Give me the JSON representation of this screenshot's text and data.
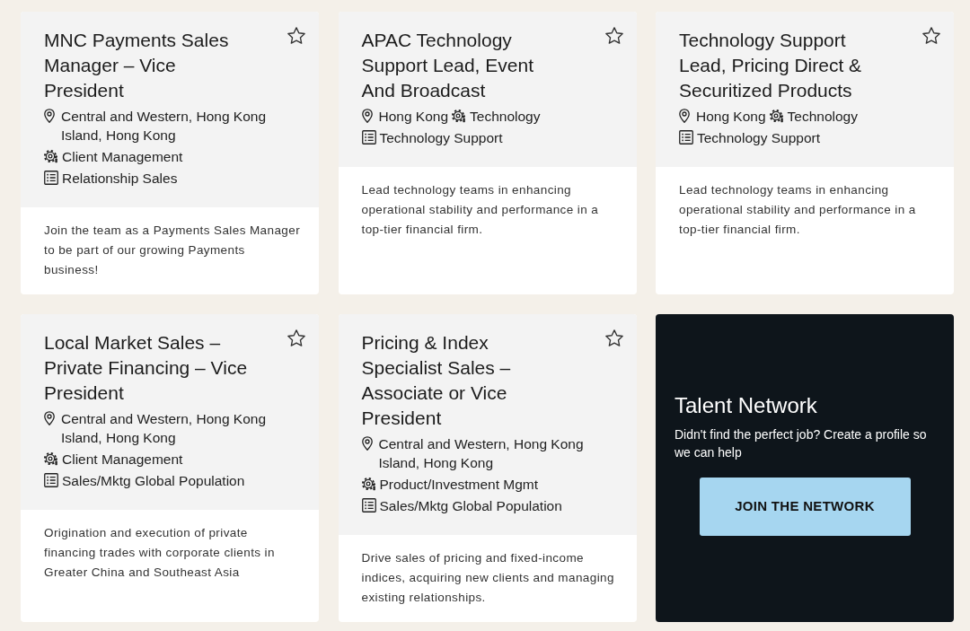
{
  "jobs": [
    {
      "title": "MNC Payments Sales Manager – Vice President",
      "saved": false,
      "details": [
        {
          "kind": "location",
          "text": "Central and Western, Hong Kong Island, Hong Kong"
        },
        {
          "kind": "category",
          "text": "Client Management"
        },
        {
          "kind": "type",
          "text": "Relationship Sales"
        }
      ],
      "summary": "Join the team as a Payments Sales Manager to be part of our growing Payments business!"
    },
    {
      "title": "APAC Technology Support Lead, Event And Broadcast",
      "saved": false,
      "details": [
        {
          "kind": "location",
          "text": "Hong Kong"
        },
        {
          "kind": "category",
          "text": "Technology"
        },
        {
          "kind": "type",
          "text": "Technology Support"
        }
      ],
      "summary": "Lead technology teams in enhancing operational stability and performance in a top-tier financial firm."
    },
    {
      "title": "Technology Support Lead, Pricing Direct & Securitized Products",
      "saved": false,
      "details": [
        {
          "kind": "location",
          "text": "Hong Kong"
        },
        {
          "kind": "category",
          "text": "Technology"
        },
        {
          "kind": "type",
          "text": "Technology Support"
        }
      ],
      "summary": "Lead technology teams in enhancing operational stability and performance in a top-tier financial firm."
    },
    {
      "title": "Local Market Sales – Private Financing – Vice President",
      "saved": false,
      "details": [
        {
          "kind": "location",
          "text": "Central and Western, Hong Kong Island, Hong Kong"
        },
        {
          "kind": "category",
          "text": "Client Management"
        },
        {
          "kind": "type",
          "text": "Sales/Mktg Global Population"
        }
      ],
      "summary": "Origination and execution of private financing trades with corporate clients in Greater China and Southeast Asia"
    },
    {
      "title": "Pricing & Index Specialist Sales – Associate or Vice President",
      "saved": false,
      "details": [
        {
          "kind": "location",
          "text": "Central and Western, Hong Kong Island, Hong Kong"
        },
        {
          "kind": "category",
          "text": "Product/Investment Mgmt"
        },
        {
          "kind": "type",
          "text": "Sales/Mktg Global Population"
        }
      ],
      "summary": "Drive sales of pricing and fixed-income indices, acquiring new clients and managing existing relationships."
    }
  ],
  "talent_network": {
    "title": "Talent Network",
    "text": "Didn't find the perfect job? Create a profile so we can help",
    "button": "JOIN THE NETWORK"
  }
}
